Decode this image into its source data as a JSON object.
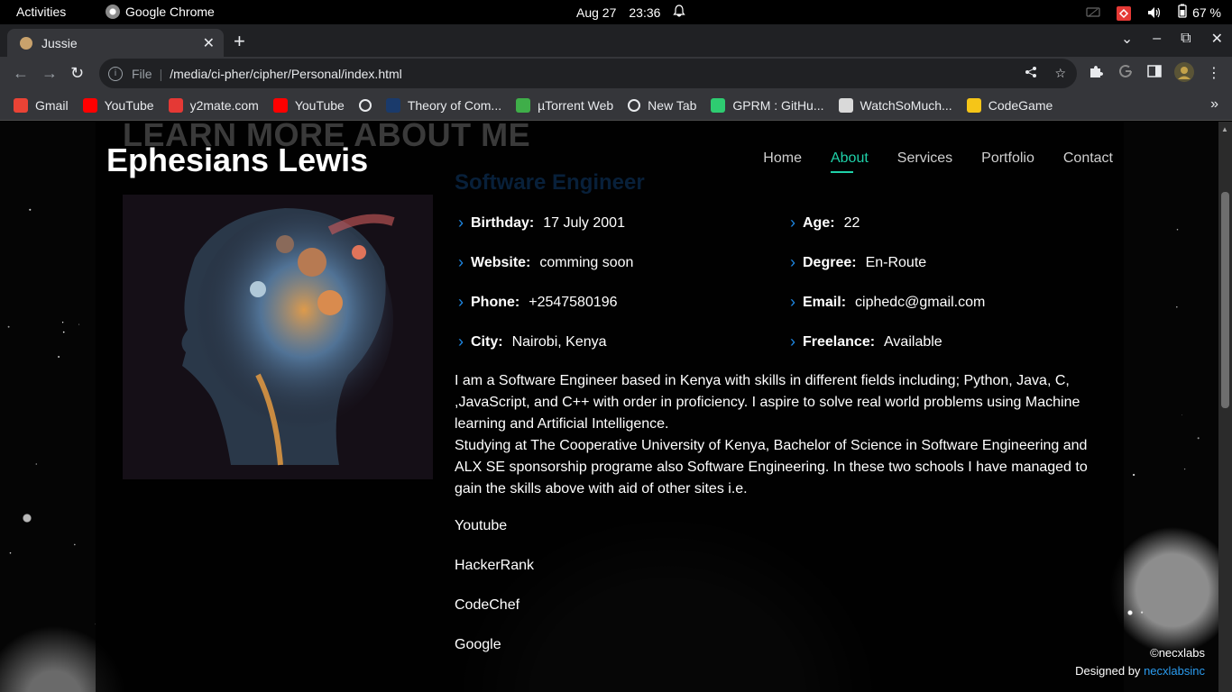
{
  "system_bar": {
    "activities": "Activities",
    "app_name": "Google Chrome",
    "date": "Aug 27",
    "time": "23:36",
    "battery": "67 %"
  },
  "browser": {
    "tab_title": "Jussie",
    "url_scheme": "File",
    "url": "/media/ci-pher/cipher/Personal/index.html",
    "bookmarks": [
      {
        "label": "Gmail",
        "icon": "gmail-icon",
        "color": "#ea4335"
      },
      {
        "label": "YouTube",
        "icon": "youtube-icon",
        "color": "#ff0000"
      },
      {
        "label": "y2mate.com",
        "icon": "y2mate-icon",
        "color": "#e53935"
      },
      {
        "label": "YouTube",
        "icon": "youtube-icon",
        "color": "#ff0000"
      },
      {
        "label": "",
        "icon": "globe-icon",
        "color": "#e8eaed"
      },
      {
        "label": "Theory of Com...",
        "icon": "theory-icon",
        "color": "#1a3a6b"
      },
      {
        "label": "µTorrent Web",
        "icon": "utorrent-icon",
        "color": "#3fae49"
      },
      {
        "label": "New Tab",
        "icon": "globe-icon",
        "color": "#e8eaed"
      },
      {
        "label": "GPRM : GitHu...",
        "icon": "gprm-icon",
        "color": "#2ecc71"
      },
      {
        "label": "WatchSoMuch...",
        "icon": "watchsomuch-icon",
        "color": "#d9d9d9"
      },
      {
        "label": "CodeGame",
        "icon": "codegame-icon",
        "color": "#f5c518"
      }
    ]
  },
  "site": {
    "ghost_heading": "LEARN MORE ABOUT ME",
    "name": "Ephesians Lewis",
    "nav": [
      {
        "label": "Home",
        "active": false
      },
      {
        "label": "About",
        "active": true
      },
      {
        "label": "Services",
        "active": false
      },
      {
        "label": "Portfolio",
        "active": false
      },
      {
        "label": "Contact",
        "active": false
      }
    ],
    "role": "Software Engineer",
    "info": {
      "birthday": {
        "label": "Birthday:",
        "value": "17 July 2001"
      },
      "age": {
        "label": "Age:",
        "value": "22"
      },
      "website": {
        "label": "Website:",
        "value": "comming soon"
      },
      "degree": {
        "label": "Degree:",
        "value": "En-Route"
      },
      "phone": {
        "label": "Phone:",
        "value": "+2547580196"
      },
      "email": {
        "label": "Email:",
        "value": "ciphedc@gmail.com"
      },
      "city": {
        "label": "City:",
        "value": "Nairobi, Kenya"
      },
      "freelance": {
        "label": "Freelance:",
        "value": "Available"
      }
    },
    "bio_p1": "I am a Software Engineer based in Kenya with skills in different fields including; Python, Java, C, ,JavaScript, and C++ with order in proficiency. I aspire to solve real world problems using Machine learning and Artificial Intelligence.",
    "bio_p2": "Studying at The Cooperative University of Kenya, Bachelor of Science in Software Engineering and ALX SE sponsorship programe also Software Engineering. In these two schools I have managed to gain the skills above with aid of other sites i.e.",
    "sites": [
      "Youtube",
      "HackerRank",
      "CodeChef",
      "Google"
    ],
    "footer": {
      "copyright": "©necxlabs",
      "designed_by": "Designed by",
      "designer": "necxlabsinc"
    }
  }
}
